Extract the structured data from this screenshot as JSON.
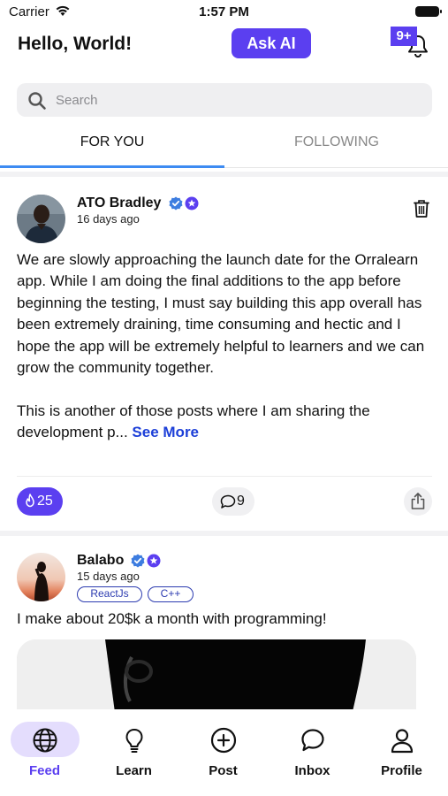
{
  "status_bar": {
    "carrier": "Carrier",
    "time": "1:57 PM"
  },
  "header": {
    "greeting": "Hello, World!",
    "ask_ai_label": "Ask AI",
    "notification_badge": "9+"
  },
  "search": {
    "placeholder": "Search",
    "value": ""
  },
  "tabs": [
    {
      "label": "FOR YOU",
      "active": true
    },
    {
      "label": "FOLLOWING",
      "active": false
    }
  ],
  "posts": [
    {
      "author": "ATO Bradley",
      "time": "16 days ago",
      "text": "We are slowly approaching the launch date for the Orralearn app. While I am doing the final additions to the app before beginning the testing, I must say building this app overall has been extremely draining, time consuming and hectic and I hope the app will be extremely helpful to learners and we can grow the community together.\n\nThis is another of those posts where I am sharing the development p... ",
      "see_more": "See More",
      "likes": "25",
      "comments": "9"
    },
    {
      "author": "Balabo",
      "time": "15 days ago",
      "tags": [
        "ReactJs",
        "C++"
      ],
      "text": "I make about 20$k a month with programming!"
    }
  ],
  "bottom_nav": [
    {
      "label": "Feed",
      "icon": "globe-icon",
      "active": true
    },
    {
      "label": "Learn",
      "icon": "lightbulb-icon",
      "active": false
    },
    {
      "label": "Post",
      "icon": "plus-circle-icon",
      "active": false
    },
    {
      "label": "Inbox",
      "icon": "chat-bubble-icon",
      "active": false
    },
    {
      "label": "Profile",
      "icon": "user-icon",
      "active": false
    }
  ],
  "colors": {
    "accent": "#5b3ff0",
    "tab_underline": "#3d8bf2",
    "link": "#1c3fd8",
    "verified": "#3d7de0"
  }
}
